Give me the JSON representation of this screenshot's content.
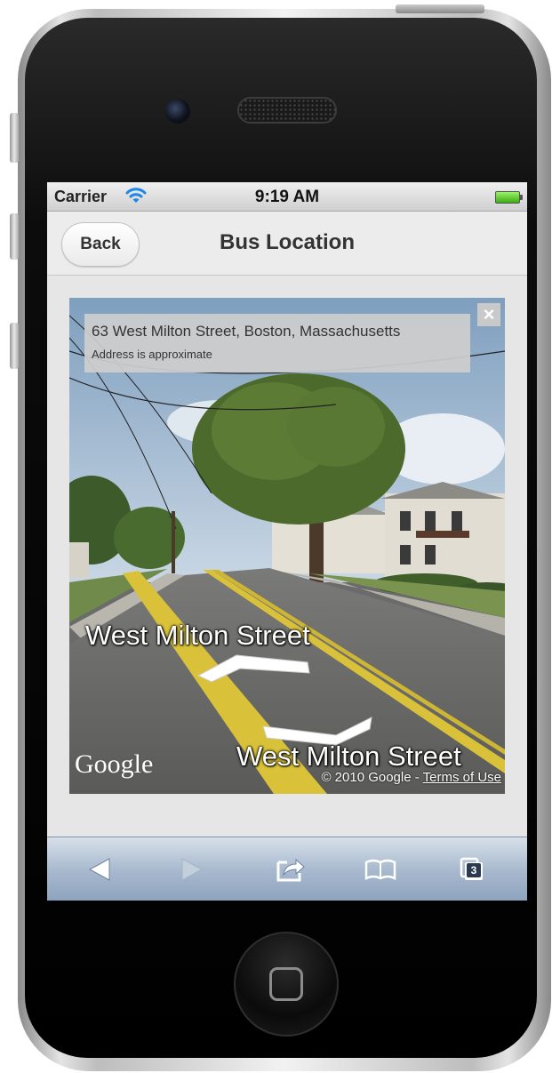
{
  "status_bar": {
    "carrier": "Carrier",
    "time": "9:19 AM"
  },
  "nav": {
    "back_label": "Back",
    "title": "Bus Location"
  },
  "street_view": {
    "address": "63 West Milton Street, Boston, Massachusetts",
    "address_note": "Address is approximate",
    "close_label": "×",
    "street_label_1": "West Milton Street",
    "street_label_2": "West Milton Street",
    "logo": "Google",
    "copyright": "© 2010 Google - ",
    "terms": "Terms of Use"
  },
  "toolbar": {
    "icons": [
      "back-arrow-icon",
      "forward-arrow-icon",
      "share-icon",
      "bookmarks-icon",
      "tabs-icon"
    ],
    "tabs_count": "3"
  },
  "colors": {
    "toolbar_top": "#d6e0ea",
    "toolbar_bottom": "#8ea3be",
    "battery": "#3dab12",
    "wifi": "#1e88e5"
  }
}
